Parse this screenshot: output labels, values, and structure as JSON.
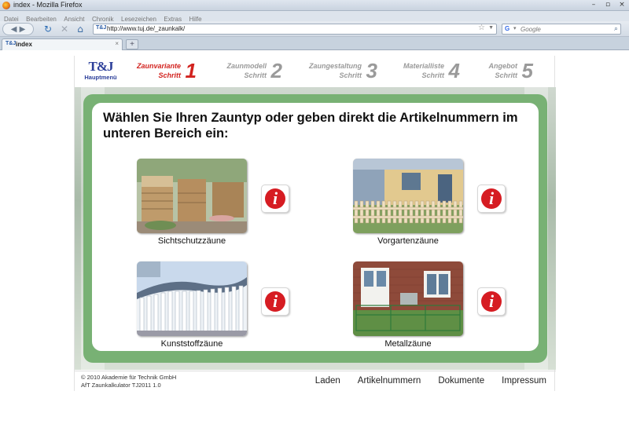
{
  "window": {
    "title": "index - Mozilla Firefox",
    "controls": [
      "–",
      "▫",
      "×"
    ]
  },
  "menu": [
    "Datei",
    "Bearbeiten",
    "Ansicht",
    "Chronik",
    "Lesezeichen",
    "Extras",
    "Hilfe"
  ],
  "nav": {
    "url": "http://www.tuj.de/_zaunkalk/",
    "search_placeholder": "Google",
    "site_icon": "T&J"
  },
  "tabs": [
    {
      "label": "index"
    }
  ],
  "site": {
    "logo": {
      "mark": "T&J",
      "label": "Hauptmenü"
    },
    "steps": [
      {
        "label": "Zaunvariante\nSchritt",
        "number": "1",
        "state": "active"
      },
      {
        "label": "Zaunmodell\nSchritt",
        "number": "2",
        "state": "inactive"
      },
      {
        "label": "Zaungestaltung\nSchritt",
        "number": "3",
        "state": "inactive"
      },
      {
        "label": "Materialliste\nSchritt",
        "number": "4",
        "state": "inactive"
      },
      {
        "label": "Angebot\nSchritt",
        "number": "5",
        "state": "inactive"
      }
    ],
    "headline": "Wählen Sie Ihren Zauntyp oder geben direkt die Artikelnummern im unteren Bereich ein:",
    "options": [
      {
        "caption": "Sichtschutzzäune",
        "info_icon": "info-icon"
      },
      {
        "caption": "Vorgartenzäune",
        "info_icon": "info-icon"
      },
      {
        "caption": "Kunststoffzäune",
        "info_icon": "info-icon"
      },
      {
        "caption": "Metallzäune",
        "info_icon": "info-icon"
      }
    ],
    "footer": {
      "copyright_line1": "© 2010 Akademie für Technik GmbH",
      "copyright_line2": "AfT Zaunkalkulator TJ2011 1.0",
      "links": [
        "Laden",
        "Artikelnummern",
        "Dokumente",
        "Impressum"
      ]
    }
  },
  "colors": {
    "accent_red": "#d2231f",
    "step_inactive": "#9a9a9a",
    "frame_green": "#78b174",
    "logo_blue": "#2c3f9a"
  }
}
